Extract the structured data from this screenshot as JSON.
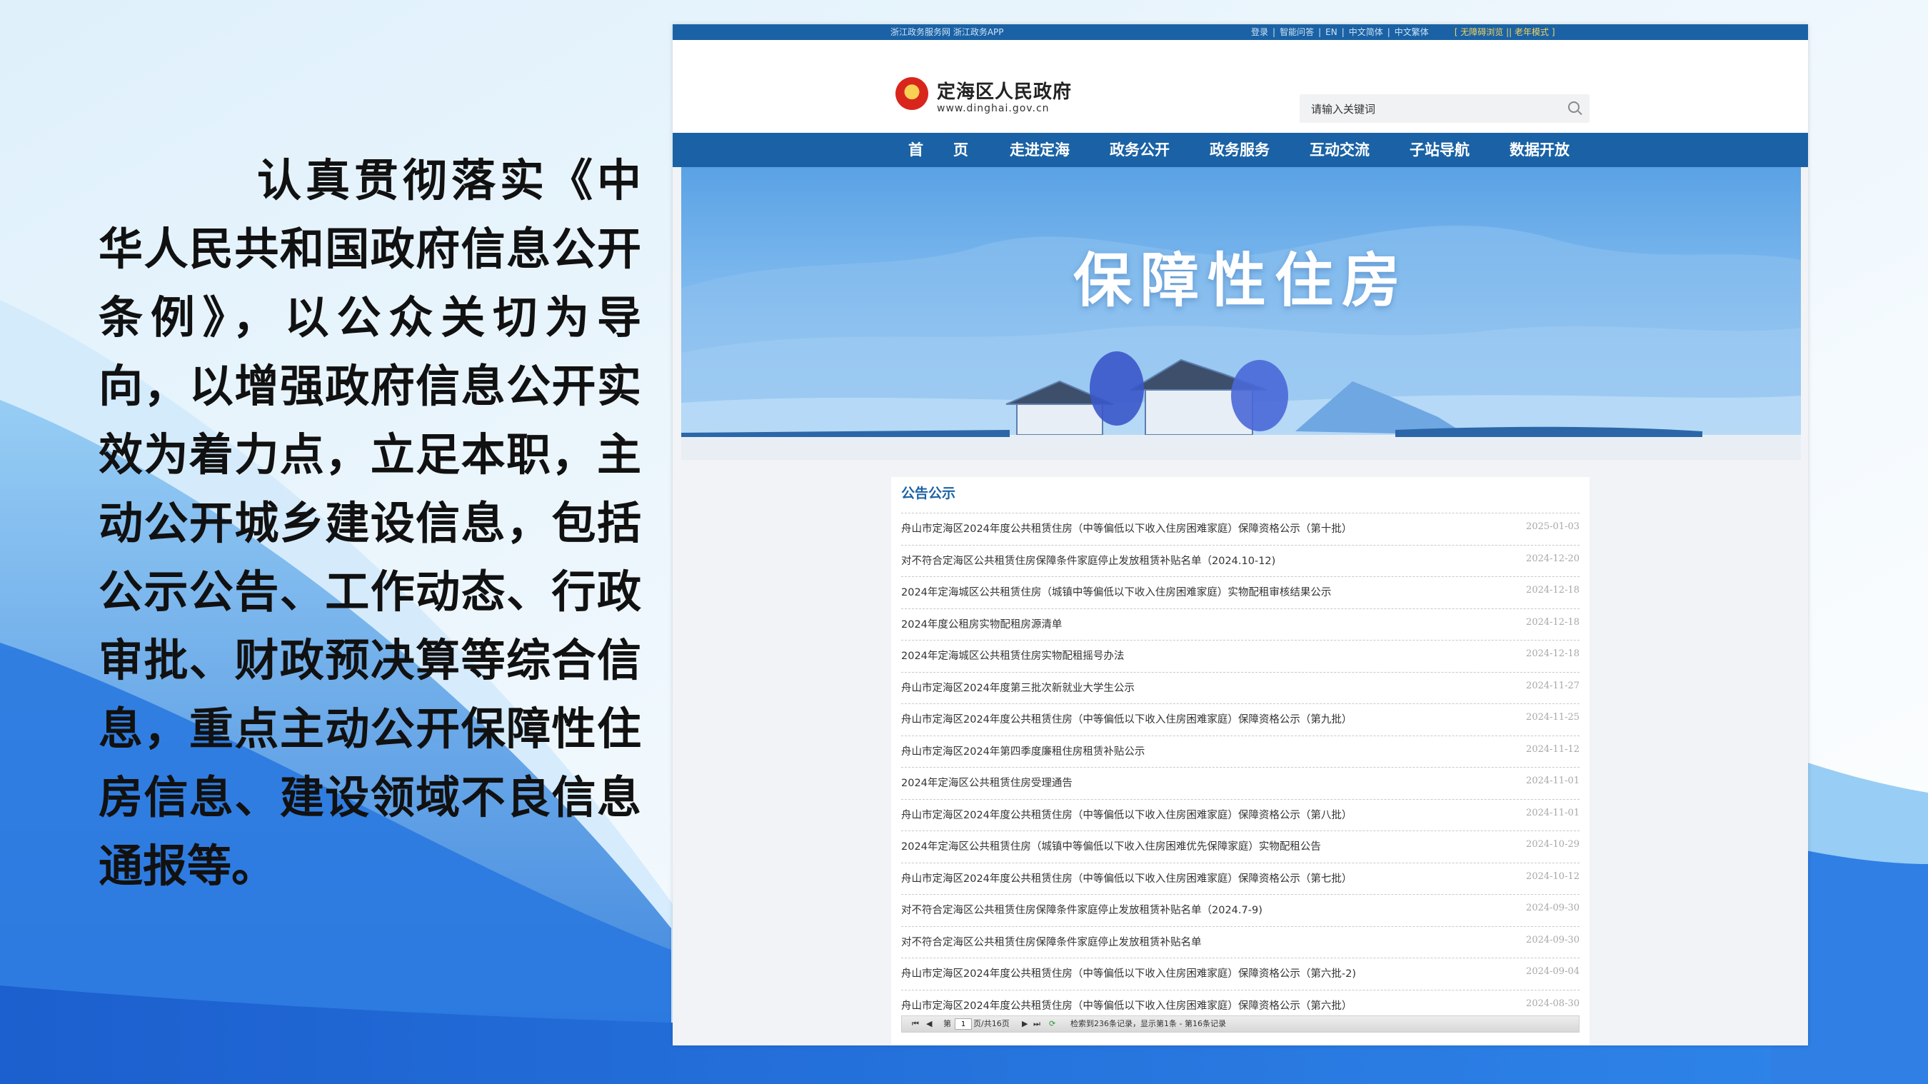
{
  "slide": {
    "paragraph": "认真贯彻落实《中华人民共和国政府信息公开条例》，以公众关切为导向，以增强政府信息公开实效为着力点，立足本职，主动公开城乡建设信息，包括公示公告、工作动态、行政审批、财政预决算等综合信息，重点主动公开保障性住房信息、建设领域不良信息通报等。"
  },
  "site": {
    "topbar_left": "浙江政务服务网 浙江政务APP",
    "topbar_links": [
      "登录",
      "|",
      "智能问答",
      "|",
      "EN",
      "|",
      "中文简体",
      "|",
      "中文繁体"
    ],
    "topbar_mode": "[ 无障碍浏览 || 老年模式 ]",
    "name": "定海区人民政府",
    "url": "www.dinghai.gov.cn",
    "search_placeholder": "请输入关键词",
    "nav": [
      "首　　页",
      "走进定海",
      "政务公开",
      "政务服务",
      "互动交流",
      "子站导航",
      "数据开放"
    ],
    "banner_title": "保障性住房"
  },
  "notices": {
    "title": "公告公示",
    "items": [
      {
        "title": "舟山市定海区2024年度公共租赁住房（中等偏低以下收入住房困难家庭）保障资格公示（第十批）",
        "date": "2025-01-03"
      },
      {
        "title": "对不符合定海区公共租赁住房保障条件家庭停止发放租赁补贴名单（2024.10-12)",
        "date": "2024-12-20"
      },
      {
        "title": "2024年定海城区公共租赁住房（城镇中等偏低以下收入住房困难家庭）实物配租审核结果公示",
        "date": "2024-12-18"
      },
      {
        "title": "2024年度公租房实物配租房源清单",
        "date": "2024-12-18"
      },
      {
        "title": "2024年定海城区公共租赁住房实物配租摇号办法",
        "date": "2024-12-18"
      },
      {
        "title": "舟山市定海区2024年度第三批次新就业大学生公示",
        "date": "2024-11-27"
      },
      {
        "title": "舟山市定海区2024年度公共租赁住房（中等偏低以下收入住房困难家庭）保障资格公示（第九批）",
        "date": "2024-11-25"
      },
      {
        "title": "舟山市定海区2024年第四季度廉租住房租赁补贴公示",
        "date": "2024-11-12"
      },
      {
        "title": "2024年定海区公共租赁住房受理通告",
        "date": "2024-11-01"
      },
      {
        "title": "舟山市定海区2024年度公共租赁住房（中等偏低以下收入住房困难家庭）保障资格公示（第八批）",
        "date": "2024-11-01"
      },
      {
        "title": "2024年定海区公共租赁住房（城镇中等偏低以下收入住房困难优先保障家庭）实物配租公告",
        "date": "2024-10-29"
      },
      {
        "title": "舟山市定海区2024年度公共租赁住房（中等偏低以下收入住房困难家庭）保障资格公示（第七批）",
        "date": "2024-10-12"
      },
      {
        "title": "对不符合定海区公共租赁住房保障条件家庭停止发放租赁补贴名单（2024.7-9)",
        "date": "2024-09-30"
      },
      {
        "title": "对不符合定海区公共租赁住房保障条件家庭停止发放租赁补贴名单",
        "date": "2024-09-30"
      },
      {
        "title": "舟山市定海区2024年度公共租赁住房（中等偏低以下收入住房困难家庭）保障资格公示（第六批-2)",
        "date": "2024-09-04"
      },
      {
        "title": "舟山市定海区2024年度公共租赁住房（中等偏低以下收入住房困难家庭）保障资格公示（第六批）",
        "date": "2024-08-30"
      }
    ]
  },
  "pager": {
    "first": "⏮",
    "prev": "◀",
    "page_prefix": "第",
    "page_value": "1",
    "page_suffix": "页/共16页",
    "next": "▶",
    "last": "⏭",
    "refresh": "⟳",
    "summary": "检索到236条记录，显示第1条 - 第16条记录"
  },
  "colors": {
    "accent": "#1a62a5",
    "banner_sky": "#6aaee9",
    "mode_link": "#f4d35a"
  }
}
